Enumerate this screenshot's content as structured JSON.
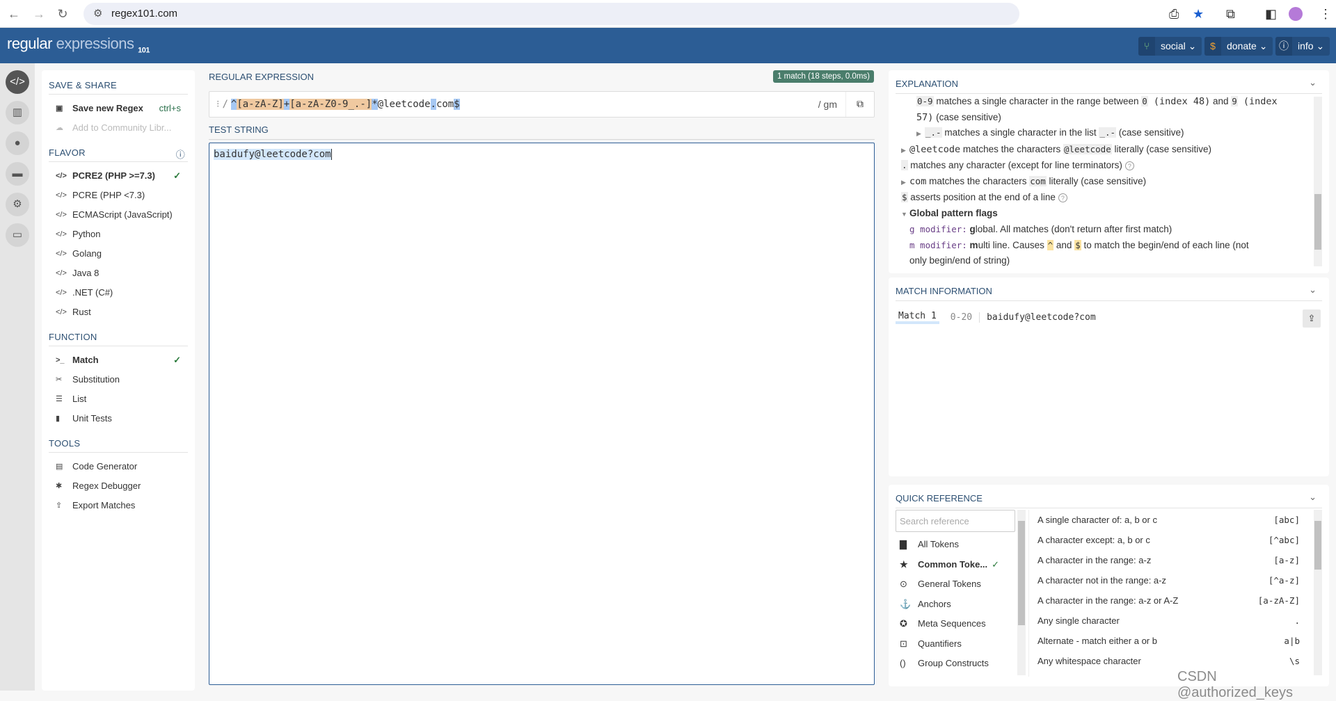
{
  "browser": {
    "url": "regex101.com"
  },
  "header": {
    "logo_a": "regular",
    "logo_b": "expressions",
    "logo_c": "101",
    "social": "social",
    "donate": "donate",
    "info": "info"
  },
  "sidebar": {
    "save_share": "SAVE & SHARE",
    "save_new": "Save new Regex",
    "save_shortcut": "ctrl+s",
    "add_community": "Add to Community Libr...",
    "flavor": "FLAVOR",
    "flavors": [
      "PCRE2 (PHP >=7.3)",
      "PCRE (PHP <7.3)",
      "ECMAScript (JavaScript)",
      "Python",
      "Golang",
      "Java 8",
      ".NET (C#)",
      "Rust"
    ],
    "function": "FUNCTION",
    "functions": [
      "Match",
      "Substitution",
      "List",
      "Unit Tests"
    ],
    "tools": "TOOLS",
    "tool_items": [
      "Code Generator",
      "Regex Debugger",
      "Export Matches"
    ]
  },
  "regex": {
    "label": "REGULAR EXPRESSION",
    "match_badge": "1 match (18 steps, 0.0ms)",
    "delim": "/",
    "flags": "/ gm",
    "tokens": [
      "^",
      "[a-zA-Z]",
      "+",
      "[a-zA-Z0-9_.-]",
      "*",
      "@leetcode",
      ".",
      "com",
      "$"
    ]
  },
  "test": {
    "label": "TEST STRING",
    "value": "baidufy@leetcode?com"
  },
  "explanation": {
    "title": "EXPLANATION",
    "l1a": "0-9",
    "l1b": " matches a single character in the range between ",
    "l1c": "0",
    "l1d": " (index 48)",
    "l1e": " and ",
    "l1f": "9",
    "l1g": " (index",
    "l2a": "57)",
    "l2b": " (case sensitive)",
    "l3a": "_.-",
    "l3b": " matches a single character in the list ",
    "l3c": "_.-",
    "l3d": " (case sensitive)",
    "l4a": "@leetcode",
    "l4b": " matches the characters ",
    "l4c": "@leetcode",
    "l4d": " literally (case sensitive)",
    "l5a": ".",
    "l5b": " matches any character (except for line terminators)",
    "l6a": "com",
    "l6b": " matches the characters ",
    "l6c": "com",
    "l6d": " literally (case sensitive)",
    "l7a": "$",
    "l7b": " asserts position at the end of a line",
    "l8": "Global pattern flags",
    "l9a": "g modifier:",
    "l9b": " g",
    "l9c": "lobal. All matches (don't return after first match)",
    "l10a": "m modifier:",
    "l10b": " m",
    "l10c": "ulti line. Causes ",
    "l10d": "^",
    "l10e": " and ",
    "l10f": "$",
    "l10g": " to match the begin/end of each line (not",
    "l11": "only begin/end of string)"
  },
  "match_info": {
    "title": "MATCH INFORMATION",
    "match_label": "Match 1",
    "range": "0-20",
    "text": "baidufy@leetcode?com"
  },
  "quick_ref": {
    "title": "QUICK REFERENCE",
    "search_placeholder": "Search reference",
    "categories": [
      "All Tokens",
      "Common Toke...",
      "General Tokens",
      "Anchors",
      "Meta Sequences",
      "Quantifiers",
      "Group Constructs"
    ],
    "rows": [
      [
        "A single character of: a, b or c",
        "[abc]"
      ],
      [
        "A character except: a, b or c",
        "[^abc]"
      ],
      [
        "A character in the range: a-z",
        "[a-z]"
      ],
      [
        "A character not in the range: a-z",
        "[^a-z]"
      ],
      [
        "A character in the range: a-z or A-Z",
        "[a-zA-Z]"
      ],
      [
        "Any single character",
        "."
      ],
      [
        "Alternate - match either a or b",
        "a|b"
      ],
      [
        "Any whitespace character",
        "\\s"
      ]
    ]
  },
  "watermark": "CSDN @authorized_keys",
  "colors": {
    "header": "#2c5d95",
    "badge": "#4a7d6b",
    "token_blue": "#a6c8f3",
    "token_orange": "#f0c9a0"
  }
}
